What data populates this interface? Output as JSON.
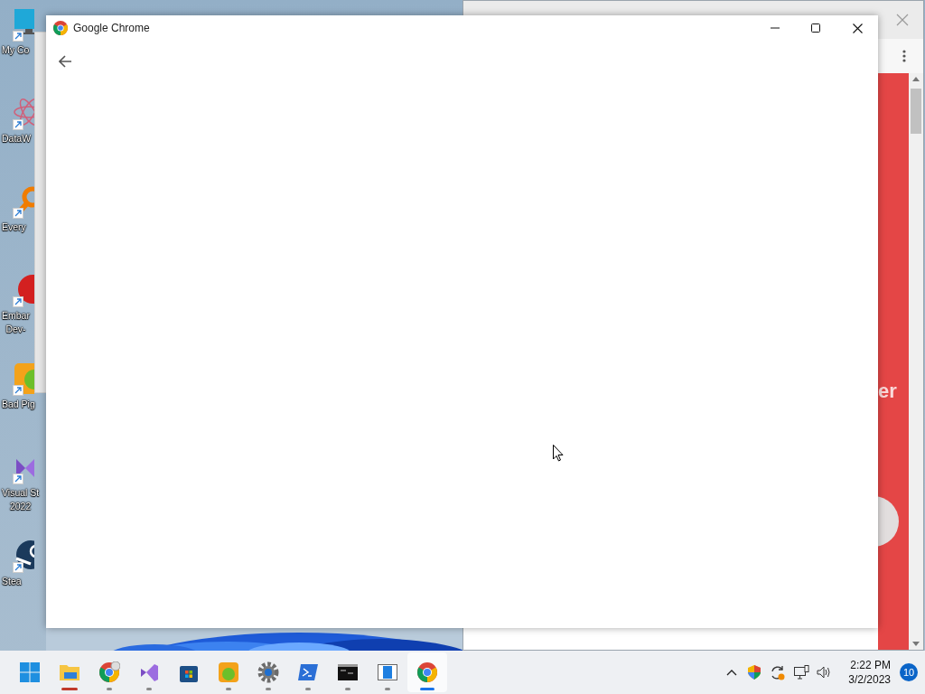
{
  "desktop": {
    "icons": [
      {
        "kind": "computer",
        "lines": [
          "My Co"
        ]
      },
      {
        "kind": "atom",
        "lines": [
          "DataW"
        ]
      },
      {
        "kind": "magnifier",
        "lines": [
          "Every"
        ]
      },
      {
        "kind": "badge",
        "lines": [
          "Embar",
          "Dev-"
        ]
      },
      {
        "kind": "pig",
        "lines": [
          "Bad Pig"
        ]
      },
      {
        "kind": "studio",
        "lines": [
          "Visual St",
          "2022"
        ]
      },
      {
        "kind": "steam",
        "lines": [
          "Stea"
        ]
      }
    ]
  },
  "background_window": {
    "overlay_text": "er"
  },
  "window": {
    "title": "Google Chrome"
  },
  "taskbar": {
    "apps": [
      {
        "kind": "start",
        "running": false,
        "flashing": false,
        "selected": false
      },
      {
        "kind": "folder",
        "running": true,
        "flashing": true,
        "selected": false
      },
      {
        "kind": "chrome-profile",
        "running": true,
        "flashing": false,
        "selected": false
      },
      {
        "kind": "studio",
        "running": true,
        "flashing": false,
        "selected": false
      },
      {
        "kind": "store",
        "running": false,
        "flashing": false,
        "selected": false
      },
      {
        "kind": "pig",
        "running": true,
        "flashing": false,
        "selected": false
      },
      {
        "kind": "gear",
        "running": true,
        "flashing": false,
        "selected": false
      },
      {
        "kind": "shell",
        "running": true,
        "flashing": false,
        "selected": false
      },
      {
        "kind": "terminal",
        "running": true,
        "flashing": false,
        "selected": false
      },
      {
        "kind": "panel",
        "running": true,
        "flashing": false,
        "selected": false
      },
      {
        "kind": "chrome",
        "running": true,
        "flashing": false,
        "selected": true
      }
    ],
    "tray": {
      "time": "2:22 PM",
      "date": "3/2/2023",
      "notifications": "10"
    }
  }
}
